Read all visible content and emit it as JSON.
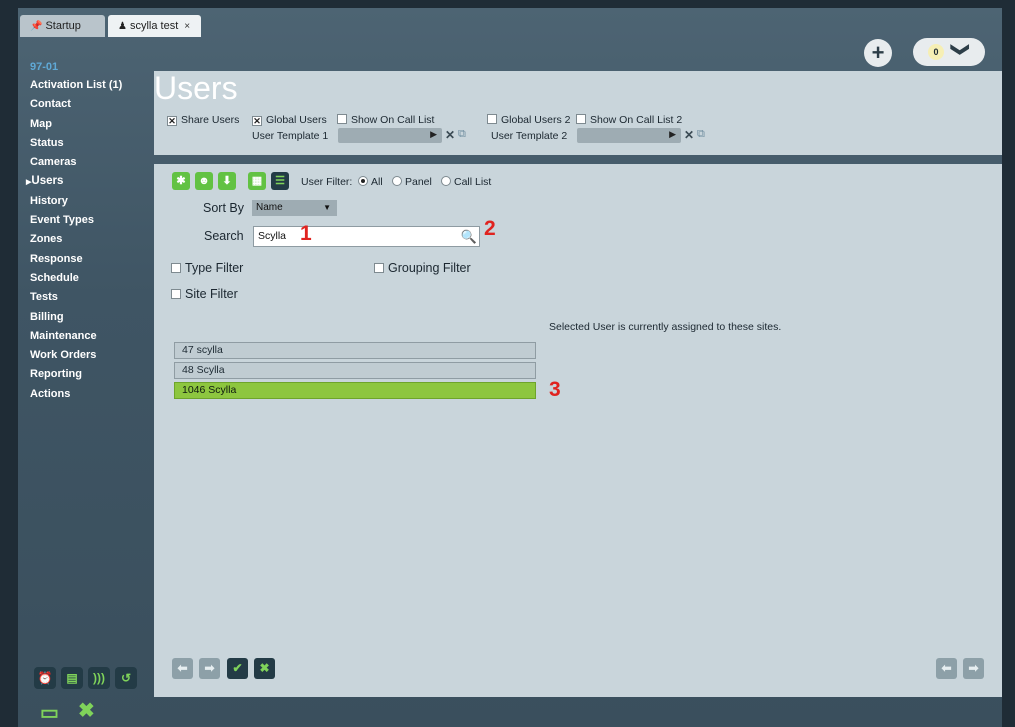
{
  "tabs": [
    {
      "label": "Startup",
      "icon": "pin-icon"
    },
    {
      "label": "scylla test",
      "icon": "users-icon",
      "close": "×"
    }
  ],
  "header": {
    "plus": "+",
    "counter": "0",
    "chevron": "❯"
  },
  "sidebar": {
    "code": "97-01",
    "items": [
      "Activation List (1)",
      "Contact",
      "Map",
      "Status",
      "Cameras",
      "Users",
      "History",
      "Event Types",
      "Zones",
      "Response",
      "Schedule",
      "Tests",
      "Billing",
      "Maintenance",
      "Work Orders",
      "Reporting",
      "Actions"
    ],
    "current": "Users"
  },
  "users_panel": {
    "title": "Users",
    "share_users": "Share Users",
    "global_users": "Global Users",
    "show_on_call_list": "Show On Call List",
    "user_template_1": "User Template 1",
    "global_users_2": "Global Users 2",
    "show_on_call_list_2": "Show On Call List 2",
    "user_template_2": "User Template 2",
    "share_users_checked": true,
    "global_users_checked": true,
    "show_on_call_list_checked": false,
    "global_users_2_checked": false,
    "show_on_call_list_2_checked": false
  },
  "toolbar": {
    "user_filter_label": "User Filter:",
    "radio_all": "All",
    "radio_panel": "Panel",
    "radio_call_list": "Call List",
    "selected_radio": "All"
  },
  "form": {
    "sort_by_label": "Sort By",
    "sort_by_value": "Name",
    "search_label": "Search",
    "search_value": "Scylla",
    "type_filter": "Type Filter",
    "grouping_filter": "Grouping Filter",
    "site_filter": "Site Filter"
  },
  "annotations": {
    "a1": "1",
    "a2": "2",
    "a3": "3"
  },
  "sites": {
    "info": "Selected User is currently assigned to these sites.",
    "rows": [
      "47 scylla",
      "48 Scylla",
      "1046 Scylla"
    ],
    "selected": "1046 Scylla"
  },
  "colors": {
    "accent_green": "#62c243",
    "selected_row": "#8dc63f",
    "annotation_red": "#e0231f",
    "sidebar_code": "#5fa9d6"
  }
}
